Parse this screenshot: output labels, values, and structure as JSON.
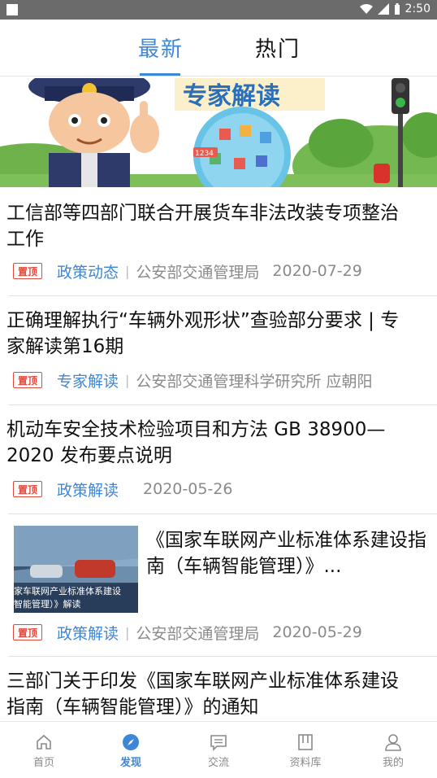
{
  "status_bar": {
    "time": "2:50"
  },
  "tabs": [
    {
      "label": "最新",
      "active": true
    },
    {
      "label": "热门",
      "active": false
    }
  ],
  "banner": {
    "headline": "专家解读",
    "badge_number": "1234"
  },
  "pin_label": "置顶",
  "articles": [
    {
      "title": "工信部等四部门联合开展货车非法改装专项整治工作",
      "category": "政策动态",
      "source": "公安部交通管理局",
      "date": "2020-07-29"
    },
    {
      "title": "正确理解执行“车辆外观形状”查验部分要求 | 专家解读第16期",
      "category": "专家解读",
      "source": "公安部交通管理科学研究所 应朝阳",
      "date": ""
    },
    {
      "title": "机动车安全技术检验项目和方法 GB 38900—2020 发布要点说明",
      "category": "政策解读",
      "source": "",
      "date": "2020-05-26"
    },
    {
      "title": "《国家车联网产业标准体系建设指南（车辆智能管理）》...",
      "category": "政策解读",
      "source": "公安部交通管理局",
      "date": "2020-05-29",
      "thumb_caption_1": "家车联网产业标准体系建设",
      "thumb_caption_2": "智能管理）》解读"
    },
    {
      "title": "三部门关于印发《国家车联网产业标准体系建设指南（车辆智能管理）》的通知"
    }
  ],
  "bottom_nav": [
    {
      "label": "首页",
      "icon": "home-icon",
      "active": false
    },
    {
      "label": "发现",
      "icon": "compass-icon",
      "active": true
    },
    {
      "label": "交流",
      "icon": "chat-icon",
      "active": false
    },
    {
      "label": "资料库",
      "icon": "book-icon",
      "active": false
    },
    {
      "label": "我的",
      "icon": "person-icon",
      "active": false
    }
  ],
  "colors": {
    "accent": "#3e86d6",
    "pin": "#e04a3c",
    "muted": "#8a8a8a",
    "status_bar": "#6b6b6b"
  }
}
